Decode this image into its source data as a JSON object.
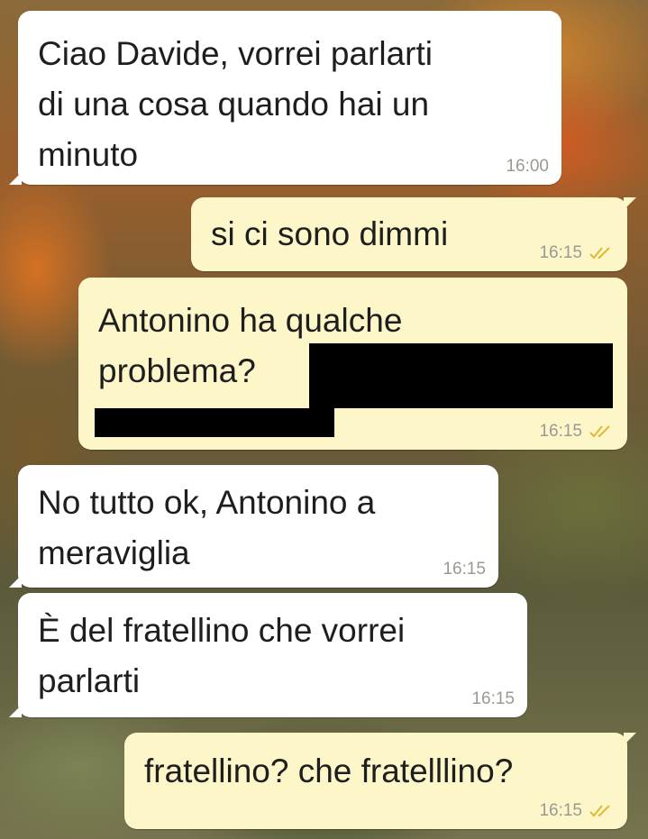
{
  "messages": [
    {
      "direction": "incoming",
      "text": "Ciao Davide, vorrei parlarti\ndi una cosa quando hai un\nminuto",
      "time": "16:00"
    },
    {
      "direction": "outgoing",
      "text": "si ci sono dimmi",
      "time": "16:15",
      "status": "read"
    },
    {
      "direction": "outgoing",
      "text": "Antonino ha qualche\nproblema?",
      "time": "16:15",
      "status": "read",
      "redacted": true
    },
    {
      "direction": "incoming",
      "text": "No tutto ok, Antonino a\nmeraviglia",
      "time": "16:15"
    },
    {
      "direction": "incoming",
      "text": "È del fratellino che vorrei\nparlarti",
      "time": "16:15"
    },
    {
      "direction": "outgoing",
      "text": "fratellino? che fratelllino?",
      "time": "16:15",
      "status": "read"
    }
  ],
  "colors": {
    "incoming_bubble": "#ffffff",
    "outgoing_bubble": "#fdf6c8",
    "timestamp": "#9a9a92",
    "read_check": "#e2b735"
  },
  "icons": {
    "read_status": "double-check-icon"
  }
}
